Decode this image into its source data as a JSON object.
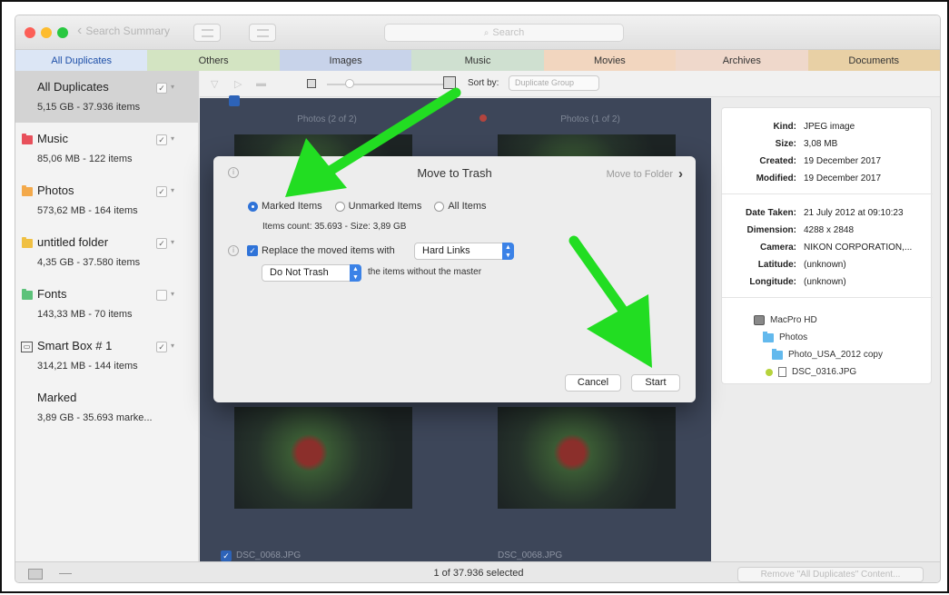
{
  "titlebar": {
    "back_label": "Search Summary",
    "search_placeholder": "Search"
  },
  "tabs": [
    {
      "label": "All Duplicates",
      "color": "#dce6f5"
    },
    {
      "label": "Others",
      "color": "#d3e4c2"
    },
    {
      "label": "Images",
      "color": "#c8d3ea"
    },
    {
      "label": "Music",
      "color": "#cfe0d0"
    },
    {
      "label": "Movies",
      "color": "#f2d6bf"
    },
    {
      "label": "Archives",
      "color": "#efd8cb"
    },
    {
      "label": "Documents",
      "color": "#e8d0a5"
    }
  ],
  "sidebar": {
    "items": [
      {
        "name": "All Duplicates",
        "sub": "5,15 GB - 37.936 items",
        "icon": "none",
        "checked": "✓"
      },
      {
        "name": "Music",
        "sub": "85,06 MB - 122 items",
        "icon": "folder-icon",
        "color": "#e8505b",
        "checked": "✓"
      },
      {
        "name": "Photos",
        "sub": "573,62 MB - 164 items",
        "icon": "folder-icon",
        "color": "#f3a94b",
        "checked": "✓"
      },
      {
        "name": "untitled folder",
        "sub": "4,35 GB - 37.580 items",
        "icon": "folder-icon",
        "color": "#f0c043",
        "checked": "✓"
      },
      {
        "name": "Fonts",
        "sub": "143,33 MB - 70 items",
        "icon": "folder-icon",
        "color": "#5cc27a",
        "checked": ""
      },
      {
        "name": "Smart Box # 1",
        "sub": "314,21 MB - 144 items",
        "icon": "smart-box-icon",
        "checked": "✓"
      },
      {
        "name": "Marked",
        "sub": "3,89 GB - 35.693 marke...",
        "icon": "none",
        "checked": null
      }
    ]
  },
  "toolbar": {
    "sort_label": "Sort by:",
    "sort_value": "Duplicate Group"
  },
  "preview": {
    "cards": [
      {
        "title": "Photos (2 of 2)",
        "file": "DSC_0068.JPG"
      },
      {
        "title": "Photos (1 of 2)",
        "file": "DSC_0068.JPG"
      }
    ]
  },
  "info": {
    "rows1": [
      {
        "label": "Kind:",
        "value": "JPEG image"
      },
      {
        "label": "Size:",
        "value": "3,08 MB"
      },
      {
        "label": "Created:",
        "value": "19 December 2017"
      },
      {
        "label": "Modified:",
        "value": "19 December 2017"
      }
    ],
    "rows2": [
      {
        "label": "Date Taken:",
        "value": "21 July 2012 at 09:10:23"
      },
      {
        "label": "Dimension:",
        "value": "4288 x 2848"
      },
      {
        "label": "Camera:",
        "value": "NIKON CORPORATION,..."
      },
      {
        "label": "Latitude:",
        "value": "(unknown)"
      },
      {
        "label": "Longitude:",
        "value": "(unknown)"
      }
    ],
    "path": [
      "MacPro HD",
      "Photos",
      "Photo_USA_2012 copy",
      "DSC_0316.JPG"
    ]
  },
  "status": {
    "selection_text": "1 of 37.936 selected",
    "remove_button": "Remove \"All Duplicates\" Content..."
  },
  "dialog": {
    "title": "Move to Trash",
    "switch_link": "Move to Folder",
    "radio_options": [
      "Marked Items",
      "Unmarked Items",
      "All Items"
    ],
    "selected_option": "Marked Items",
    "items_count": "Items count: 35.693 - Size: 3,89 GB",
    "replace_label": "Replace the moved items with",
    "replace_value": "Hard Links",
    "trash_mode_value": "Do Not Trash",
    "without_master_label": "the items without the master",
    "cancel_button": "Cancel",
    "start_button": "Start"
  },
  "colors": {
    "annotation_arrow": "#22dd22",
    "accent_blue": "#2f73d8"
  }
}
